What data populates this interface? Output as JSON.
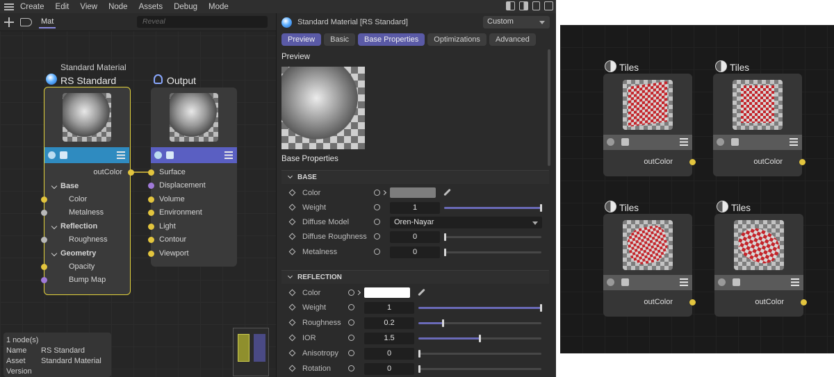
{
  "menu": {
    "items": [
      "Create",
      "Edit",
      "View",
      "Node",
      "Assets",
      "Debug",
      "Mode"
    ]
  },
  "node_editor": {
    "tab": "Mat",
    "reveal_placeholder": "Reveal",
    "material_node": {
      "subtitle": "Standard Material",
      "title": "RS Standard",
      "output_port": "outColor",
      "groups": [
        {
          "label": "Base",
          "ports": [
            "Color",
            "Metalness"
          ]
        },
        {
          "label": "Reflection",
          "ports": [
            "Roughness"
          ]
        },
        {
          "label": "Geometry",
          "ports": [
            "Opacity",
            "Bump Map"
          ]
        }
      ]
    },
    "output_node": {
      "title": "Output",
      "ports": [
        "Surface",
        "Displacement",
        "Volume",
        "Environment",
        "Light",
        "Contour",
        "Viewport"
      ]
    },
    "info": {
      "count": "1 node(s)",
      "name_key": "Name",
      "name_value": "RS Standard",
      "asset_key": "Asset",
      "asset_value": "Standard Material",
      "version_key": "Version"
    }
  },
  "attributes": {
    "title": "Standard Material [RS Standard]",
    "mode": "Custom",
    "tabs": [
      "Preview",
      "Basic",
      "Base Properties",
      "Optimizations",
      "Advanced"
    ],
    "preview_label": "Preview",
    "base_properties_label": "Base Properties",
    "base": {
      "header": "BASE",
      "color_label": "Color",
      "color_value": "#7d7d7d",
      "weight_label": "Weight",
      "weight_value": "1",
      "diffuse_model_label": "Diffuse Model",
      "diffuse_model_value": "Oren-Nayar",
      "diffuse_roughness_label": "Diffuse Roughness",
      "diffuse_roughness_value": "0",
      "metalness_label": "Metalness",
      "metalness_value": "0"
    },
    "reflection": {
      "header": "REFLECTION",
      "color_label": "Color",
      "color_value": "#ffffff",
      "weight_label": "Weight",
      "weight_value": "1",
      "roughness_label": "Roughness",
      "roughness_value": "0.2",
      "ior_label": "IOR",
      "ior_value": "1.5",
      "anisotropy_label": "Anisotropy",
      "anisotropy_value": "0",
      "rotation_label": "Rotation",
      "rotation_value": "0"
    }
  },
  "tiles_canvas": {
    "nodes": [
      {
        "title": "Tiles",
        "port": "outColor"
      },
      {
        "title": "Tiles",
        "port": "outColor"
      },
      {
        "title": "Tiles",
        "port": "outColor"
      },
      {
        "title": "Tiles",
        "port": "outColor"
      }
    ]
  }
}
